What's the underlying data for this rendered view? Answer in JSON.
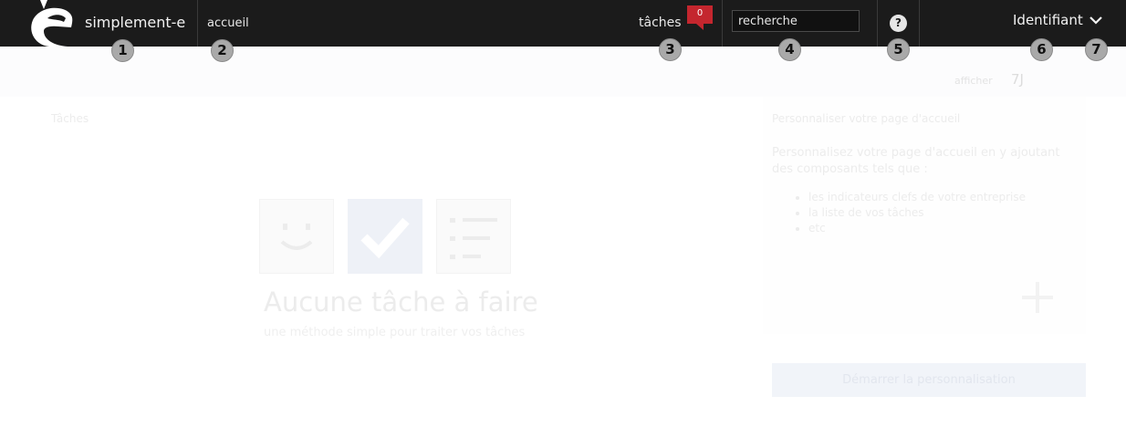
{
  "header": {
    "brand": "simplement-e",
    "nav_home": "accueil",
    "nav_tasks": "tâches",
    "task_count": "0",
    "search_placeholder": "recherche",
    "help_label": "?",
    "user_label": "Identifiant"
  },
  "markers": [
    "1",
    "2",
    "3",
    "4",
    "5",
    "6",
    "7"
  ],
  "display": {
    "label": "afficher",
    "value": "7J"
  },
  "tasks_panel": {
    "title": "Tâches",
    "empty_title": "Aucune tâche à faire",
    "empty_subtitle": "une méthode simple pour traiter vos tâches"
  },
  "customize_panel": {
    "title": "Personnaliser votre page d'accueil",
    "description": "Personnalisez votre page d'accueil en y ajoutant des composants tels que :",
    "items": [
      "les indicateurs clefs de votre entreprise",
      "la liste de vos tâches",
      "etc"
    ],
    "start_button": "Démarrer la personnalisation"
  },
  "colors": {
    "topbar": "#1b1b1b",
    "badge": "#c4262e",
    "marker": "#a9a9a9"
  }
}
